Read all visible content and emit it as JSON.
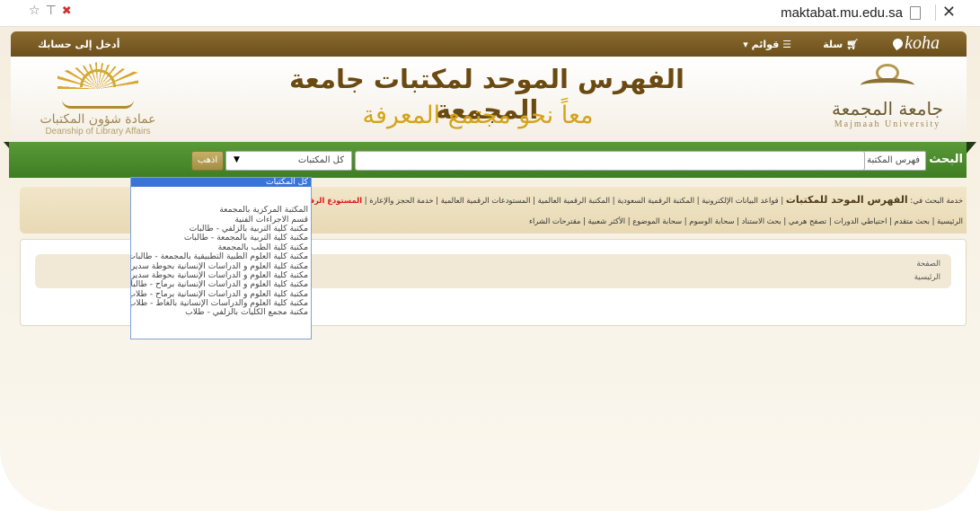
{
  "browser": {
    "url": "maktabat.mu.edu.sa",
    "icons": [
      "bookmark-star-icon",
      "pin-icon",
      "broken-lock-icon"
    ],
    "close_label": "✕"
  },
  "topbar": {
    "brand": "koha",
    "cart": "سلة",
    "lists": "قوائم",
    "login": "أدخل إلى حسابك"
  },
  "banner": {
    "title": "الفهرس الموحد لمكتبات جامعة المجمعة",
    "slogan": "معاً نحو مجتمع المعرفة",
    "left_logo_ar": "عمادة شؤون المكتبات",
    "left_logo_en": "Deanship of Library Affairs",
    "right_logo_ar": "جامعة المجمعة",
    "right_logo_en": "Majmaah University"
  },
  "search": {
    "label": "البحث",
    "category": "فهرس المكتبة",
    "query": "",
    "library": "كل المكتبات",
    "go": "اذهب"
  },
  "library_options": [
    "كل المكتبات",
    "",
    "",
    "المكتبة المركزية بالمجمعة",
    "قسم الاجراءات الفنية",
    "مكتبة كلية التربية بالزلفي - طالبات",
    "مكتبة كلية التربية بالمجمعة - طالبات",
    "مكتبة كلية الطب بالمجمعة",
    "مكتبة كلية العلوم الطبية التطبيقية بالمجمعة - طالبات",
    "مكتبة كلية العلوم و الدراسات الإنسانية بحوطة سدير - طالبات",
    "مكتبة كلية العلوم و الدراسات الإنسانية بحوطة سدير - طلاب",
    "مكتبة كلية العلوم و الدراسات الإنسانية برماح - طالبات",
    "مكتبة كلية العلوم و الدراسات الإنسانية برماح - طلاب",
    "مكتبة كلية العلوم والدراسات الإنسانية بالغاط - طلاب",
    "مكتبة مجمع الكليات بالزلفي - طلاب"
  ],
  "links": {
    "prefix": "خدمة البحث في:",
    "main": "الفهرس الموحد للمكتبات",
    "row1": "| قواعد البيانات الإلكترونية | المكتبة الرقمية السعودية | المكتبة الرقمية العالمية | المستودعات الرقمية العالمية | خدمة الحجز والإعارة |",
    "red": "المستودع الرقمي",
    "row2": "الرئيسية | بحث متقدم | احتياطي الدورات | تصفح هرمي | بحث الاستناد | سحابة الوسوم | سحابة الموضوع | الأكثر شعبية | مقترحات الشراء"
  },
  "breadcrumb": {
    "line1": "الصفحة",
    "line2": "الرئيسية"
  }
}
